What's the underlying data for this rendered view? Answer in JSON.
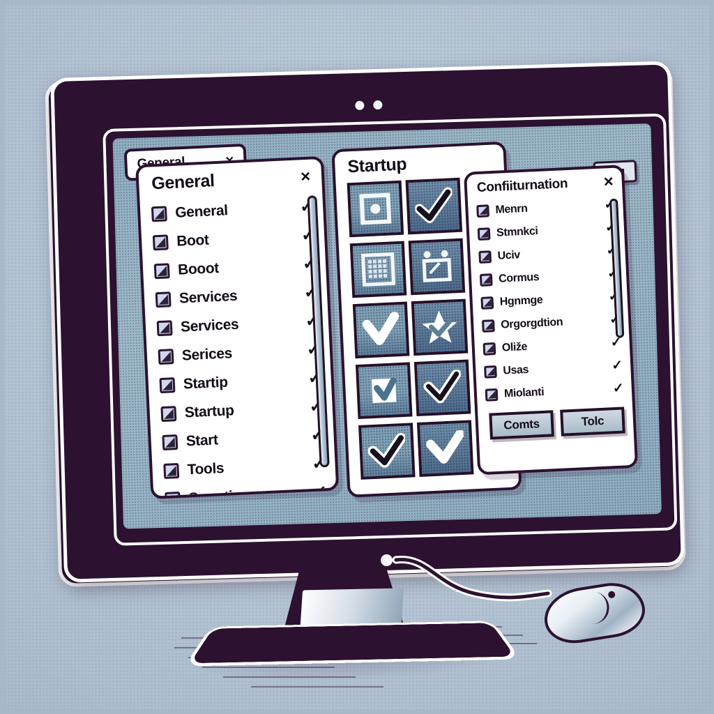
{
  "scene": {
    "device": "desktop-monitor",
    "colors": {
      "desk_background": "#b9c8d7",
      "bezel": "#2c1130",
      "screen_desktop": "#8fb0c2",
      "window_background": "#ffffff",
      "tile_blue": "#7fa3b8",
      "button_face": "#a8bcca",
      "accent_tick": "#17101f"
    }
  },
  "taskbar_tab": {
    "label": "General",
    "close_icon": "×"
  },
  "window_controls": {
    "minimize_icon": "minimize",
    "maximize_icon": "maximize"
  },
  "windows": {
    "general": {
      "title": "General",
      "close_icon": "×",
      "items": [
        {
          "label": "General",
          "checked": true,
          "tick": "✓"
        },
        {
          "label": "Boot",
          "checked": true,
          "tick": "✓"
        },
        {
          "label": "Booot",
          "checked": true,
          "tick": "✓"
        },
        {
          "label": "Services",
          "checked": true,
          "tick": "✓"
        },
        {
          "label": "Services",
          "checked": true,
          "tick": "✓"
        },
        {
          "label": "Serices",
          "checked": true,
          "tick": "✓"
        },
        {
          "label": "Startip",
          "checked": true,
          "tick": "✓"
        },
        {
          "label": "Startup",
          "checked": true,
          "tick": "✓"
        },
        {
          "label": "Start",
          "checked": true,
          "tick": "✓"
        },
        {
          "label": "Tools",
          "checked": true,
          "tick": "✓"
        },
        {
          "label": "Sonntinp",
          "checked": true,
          "tick": "✓"
        }
      ]
    },
    "startup": {
      "title": "Startup",
      "tiles": [
        [
          {
            "icon": "square-dot-icon"
          },
          {
            "icon": "bold-check-icon"
          }
        ],
        [
          {
            "icon": "grid-calendar-icon"
          },
          {
            "icon": "window-frame-icon"
          }
        ],
        [
          {
            "icon": "white-check-icon"
          },
          {
            "icon": "star-icon"
          }
        ],
        [
          {
            "icon": "checkbox-check-icon"
          },
          {
            "icon": "white-check-icon"
          }
        ],
        [
          {
            "icon": "dark-check-icon"
          },
          {
            "icon": "white-check-icon"
          }
        ]
      ]
    },
    "configuration": {
      "title": "Confiiturnation",
      "close_icon": "×",
      "items": [
        {
          "label": "Menrn",
          "checked": true,
          "tick": "✓"
        },
        {
          "label": "Stmnkci",
          "checked": true,
          "tick": "✓"
        },
        {
          "label": "Uciv",
          "checked": true,
          "tick": "✓"
        },
        {
          "label": "Cormus",
          "checked": true,
          "tick": "✓"
        },
        {
          "label": "Hgnmge",
          "checked": true,
          "tick": "✓"
        },
        {
          "label": "Orgorgdtion",
          "checked": true,
          "tick": "✓"
        },
        {
          "label": "Oliže",
          "checked": true,
          "tick": "✓"
        },
        {
          "label": "Usas",
          "checked": true,
          "tick": "✓"
        },
        {
          "label": "Miolanti",
          "checked": true,
          "tick": "✓"
        }
      ],
      "buttons": [
        {
          "label": "Comts"
        },
        {
          "label": "Tolс"
        }
      ]
    }
  },
  "peripherals": {
    "mouse": "computer-mouse",
    "cord": "mouse-cord",
    "power_led": "power-indicator"
  }
}
